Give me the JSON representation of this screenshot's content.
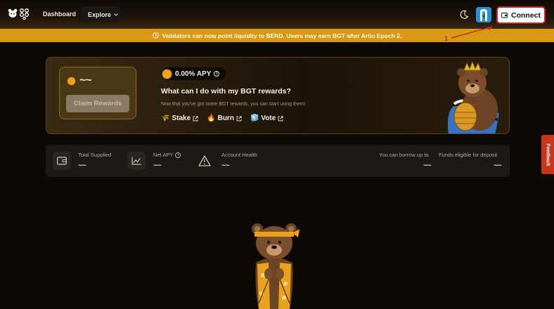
{
  "nav": {
    "dashboard_label": "Dashboard",
    "explore_label": "Explore",
    "connect_label": "Connect"
  },
  "banner": {
    "text": "Validators can now point liquidity to BEND. Users may earn BGT after Artio Epoch 2."
  },
  "annotation": {
    "number": "1"
  },
  "rewards": {
    "claim_value": "~~",
    "claim_button": "Claim Rewards",
    "apy": "0.00% APY",
    "heading": "What can I do with my BGT rewards?",
    "subtext": "Now that you've got some BGT rewards, you can start using them!",
    "actions": [
      {
        "emoji": "🌾",
        "label": "Stake"
      },
      {
        "emoji": "🔥",
        "label": "Burn"
      },
      {
        "emoji": "🧊",
        "label": "Vote"
      }
    ]
  },
  "stats": {
    "total_supplied": {
      "label": "Total Supplied",
      "value": "~~"
    },
    "net_apy": {
      "label": "Net APY",
      "value": "~~"
    },
    "account_health": {
      "label": "Account Health",
      "value": "~~"
    },
    "borrow_up_to": {
      "label": "You can borrow up to",
      "value": "~~"
    },
    "funds_eligible": {
      "label": "Funds eligible for deposit",
      "value": "~~"
    }
  },
  "feedback": {
    "label": "Feedback"
  },
  "colors": {
    "banner": "#d89a14",
    "connect_border": "#d0202a",
    "feedback": "#c8341c",
    "background": "#0e0905"
  },
  "icons": [
    "bear-logo-icon",
    "chain-logo-icon",
    "chevron-down-icon",
    "moon-icon",
    "wallet-icon",
    "clock-icon",
    "info-icon",
    "external-link-icon",
    "warning-icon",
    "chart-icon"
  ]
}
